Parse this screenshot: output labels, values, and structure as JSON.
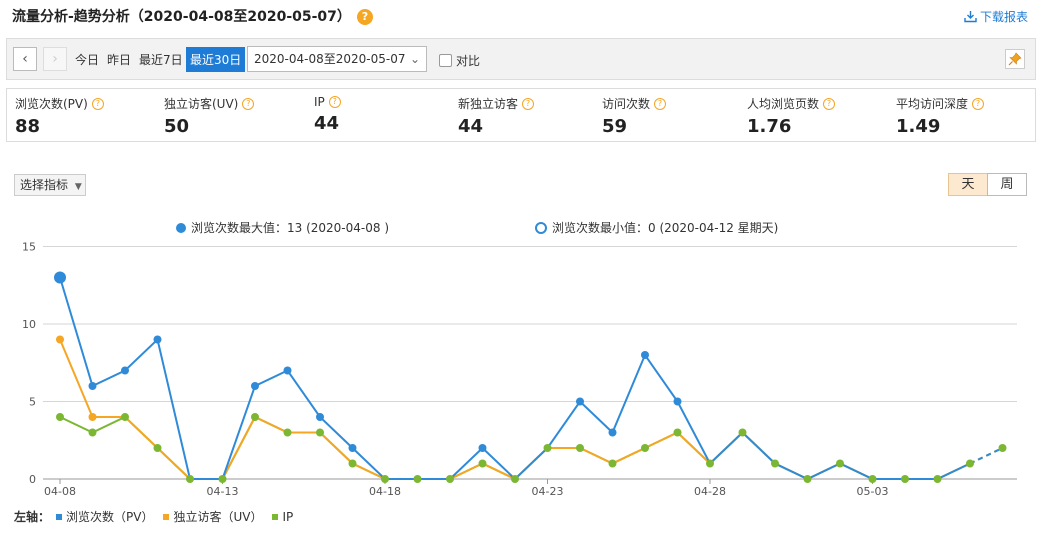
{
  "header": {
    "title": "流量分析-趋势分析（2020-04-08至2020-05-07）",
    "help_glyph": "?",
    "download_label": "下载报表"
  },
  "toolbar": {
    "quick_ranges": [
      "今日",
      "昨日",
      "最近7日",
      "最近30日"
    ],
    "active_range": "最近30日",
    "date_range_value": "2020-04-08至2020-05-07",
    "compare_label": "对比"
  },
  "metrics": [
    {
      "label": "浏览次数(PV)",
      "value": "88"
    },
    {
      "label": "独立访客(UV)",
      "value": "50"
    },
    {
      "label": "IP",
      "value": "44"
    },
    {
      "label": "新独立访客",
      "value": "44"
    },
    {
      "label": "访问次数",
      "value": "59"
    },
    {
      "label": "人均浏览页数",
      "value": "1.76"
    },
    {
      "label": "平均访问深度",
      "value": "1.49"
    }
  ],
  "chart_controls": {
    "select_metric_label": "选择指标",
    "granularity_day": "天",
    "granularity_week": "周"
  },
  "chart_annotations": {
    "max_label": "浏览次数最大值：13 (2020-04-08 )",
    "min_label": "浏览次数最小值：0 (2020-04-12 星期天)"
  },
  "bottom_legend": {
    "axis_label": "左轴：",
    "items": [
      {
        "name": "浏览次数（PV）",
        "color": "#2f8ad8"
      },
      {
        "name": "独立访客（UV）",
        "color": "#f5a623"
      },
      {
        "name": "IP",
        "color": "#7cb733"
      }
    ]
  },
  "chart_data": {
    "type": "line",
    "ylim": [
      0,
      15
    ],
    "yticks": [
      0,
      5,
      10,
      15
    ],
    "x_tick_labels": [
      "04-08",
      "04-13",
      "04-18",
      "04-23",
      "04-28",
      "05-03"
    ],
    "x_tick_indices": [
      0,
      5,
      10,
      15,
      20,
      25
    ],
    "num_points": 30,
    "series": [
      {
        "name": "浏览次数（PV）",
        "color": "#2f8ad8",
        "values": [
          13,
          6,
          7,
          9,
          0,
          0,
          6,
          7,
          4,
          2,
          0,
          0,
          0,
          2,
          0,
          2,
          5,
          3,
          8,
          5,
          1,
          3,
          1,
          0,
          1,
          0,
          0,
          0,
          1,
          2
        ]
      },
      {
        "name": "独立访客（UV）",
        "color": "#f5a623",
        "values": [
          9,
          4,
          4,
          2,
          0,
          0,
          4,
          3,
          3,
          1,
          0,
          0,
          0,
          1,
          0,
          2,
          2,
          1,
          2,
          3,
          1,
          3,
          1,
          0,
          1,
          0,
          0,
          0,
          1,
          2
        ]
      },
      {
        "name": "IP",
        "color": "#7cb733",
        "values": [
          4,
          3,
          4,
          2,
          0,
          0,
          4,
          3,
          3,
          1,
          0,
          0,
          0,
          1,
          0,
          2,
          2,
          1,
          2,
          3,
          1,
          3,
          1,
          0,
          1,
          0,
          0,
          0,
          1,
          2
        ]
      }
    ],
    "max_point_index": 0
  }
}
